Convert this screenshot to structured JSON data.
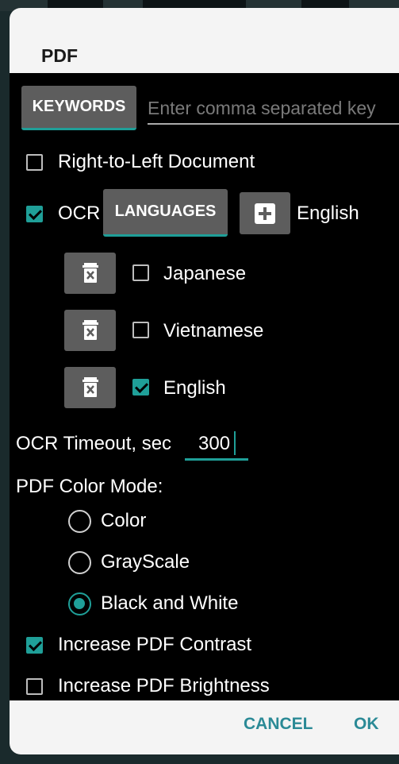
{
  "dialog": {
    "title": "PDF"
  },
  "keywords": {
    "button_label": "KEYWORDS",
    "placeholder": "Enter comma separated key"
  },
  "rtl": {
    "label": "Right-to-Left Document",
    "checked": false
  },
  "ocr": {
    "label": "OCR",
    "checked": true,
    "languages_label": "LANGUAGES",
    "add_icon": "plus-icon",
    "selected_language": "English",
    "languages": [
      {
        "name": "Japanese",
        "checked": false,
        "icon": "trash-icon"
      },
      {
        "name": "Vietnamese",
        "checked": false,
        "icon": "trash-icon"
      },
      {
        "name": "English",
        "checked": true,
        "icon": "trash-icon"
      }
    ],
    "timeout_label": "OCR Timeout, sec",
    "timeout_value": "300"
  },
  "color_mode": {
    "label": "PDF Color Mode:",
    "options": [
      {
        "label": "Color",
        "selected": false
      },
      {
        "label": "GrayScale",
        "selected": false
      },
      {
        "label": "Black and White",
        "selected": true
      }
    ]
  },
  "contrast": {
    "label": "Increase PDF Contrast",
    "checked": true
  },
  "brightness": {
    "label": "Increase PDF Brightness",
    "checked": false
  },
  "footer": {
    "cancel_label": "CANCEL",
    "ok_label": "OK"
  },
  "colors": {
    "accent": "#1f9f98",
    "button_bg": "#5d5d5d",
    "dialog_bg": "#000000",
    "header_bg": "#f4f4f4",
    "footer_text": "#2b8a96"
  }
}
